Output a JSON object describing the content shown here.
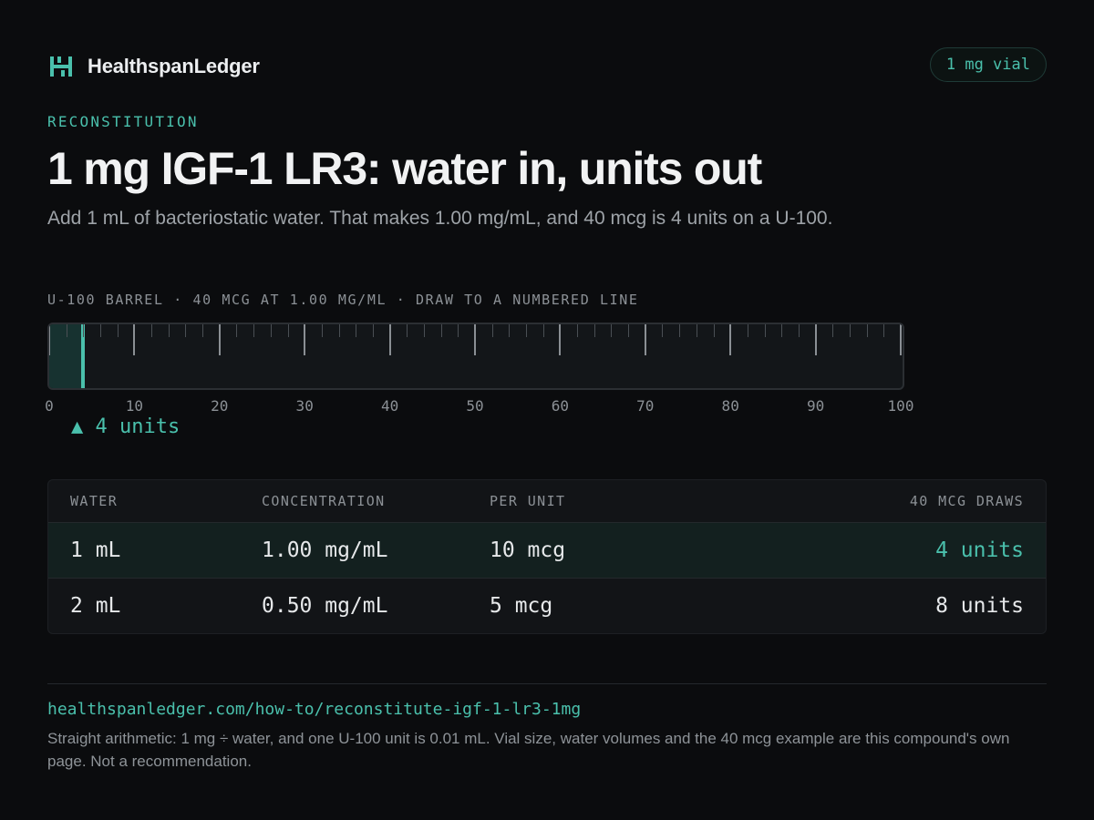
{
  "header": {
    "brand_name": "HealthspanLedger",
    "vial_badge": "1 mg vial"
  },
  "hero": {
    "eyebrow": "RECONSTITUTION",
    "title": "1 mg IGF-1 LR3: water in, units out",
    "subtitle": "Add 1 mL of bacteriostatic water. That makes 1.00 mg/mL, and 40 mcg is 4 units on a U-100."
  },
  "syringe": {
    "caption": "U-100 BARREL · 40 MCG AT 1.00 MG/ML · DRAW TO A NUMBERED LINE",
    "max_units": 100,
    "fill_units": 4,
    "tick_labels": [
      "0",
      "10",
      "20",
      "30",
      "40",
      "50",
      "60",
      "70",
      "80",
      "90",
      "100"
    ],
    "marker_label": "▲ 4 units"
  },
  "table": {
    "headers": [
      "WATER",
      "CONCENTRATION",
      "PER UNIT",
      "40 MCG DRAWS"
    ],
    "rows": [
      {
        "water": "1 mL",
        "concentration": "1.00 mg/mL",
        "per_unit": "10 mcg",
        "draw": "4 units",
        "highlighted": true
      },
      {
        "water": "2 mL",
        "concentration": "0.50 mg/mL",
        "per_unit": "5 mcg",
        "draw": "8 units",
        "highlighted": false
      }
    ]
  },
  "footer": {
    "url": "healthspanledger.com/how-to/reconstitute-igf-1-lr3-1mg",
    "note": "Straight arithmetic: 1 mg ÷ water, and one U-100 unit is 0.01 mL. Vial size, water volumes and the 40 mcg example are this compound's own page. Not a recommendation."
  },
  "colors": {
    "accent": "#4ac0ac",
    "background": "#0b0c0e"
  },
  "icons": {
    "brand": "brand-logo-icon",
    "marker": "triangle-up"
  }
}
